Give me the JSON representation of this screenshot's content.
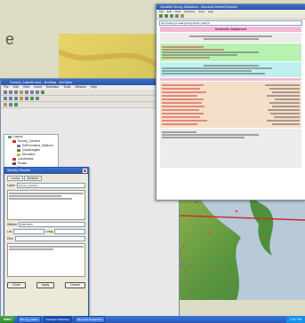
{
  "slide": {
    "partial_text": "e"
  },
  "app": {
    "title": "Survey_Labels.mxd - ArcMap - ArcView",
    "menu": [
      "File",
      "Edit",
      "View",
      "Insert",
      "Selection",
      "Tools",
      "Window",
      "Help"
    ],
    "toc": {
      "items": [
        {
          "label": "Layers",
          "level": 1,
          "color": "#888888"
        },
        {
          "label": "Survey_Centers",
          "level": 2,
          "color": "#c0392b"
        },
        {
          "label": "SelFunctions_Stations",
          "level": 3,
          "color": "#7d7d7d"
        },
        {
          "label": "Quadrangles",
          "level": 3,
          "color": "#4e8b52"
        },
        {
          "label": "Elevation",
          "level": 3,
          "color": "#d8b34a"
        },
        {
          "label": "Landmarks",
          "level": 2,
          "color": "#c0392b"
        },
        {
          "label": "Roads",
          "level": 2,
          "color": "#555555"
        },
        {
          "label": "Rivers",
          "level": 2,
          "color": "#2f6fd0"
        }
      ]
    }
  },
  "dialog": {
    "title": "Identify Results",
    "tabs": [
      "Location",
      "Attributes"
    ],
    "fields": [
      {
        "label": "Layer",
        "value": "Survey_Centers"
      },
      {
        "label": "Station",
        "value": "W30-0072"
      },
      {
        "label": "Lat",
        "value": ""
      },
      {
        "label": "Long",
        "value": ""
      },
      {
        "label": "Elev",
        "value": ""
      }
    ],
    "buttons": [
      "Close",
      "Apply",
      "Cancel"
    ]
  },
  "browser": {
    "title": "Geodetic Survey Datasheet - Microsoft Internet Explorer",
    "menu": [
      "File",
      "Edit",
      "View",
      "Favorites",
      "Tools",
      "Help"
    ],
    "address": "http://www.ngs.noaa.gov/cgi-bin/ds_mark.prl",
    "heading": "Geodetic Datasheet"
  },
  "taskbar": {
    "start_label": "start",
    "tasks": [
      "Survey_Labels",
      "Geodetic Datasheet",
      "Microsoft PowerPoint"
    ],
    "clock": "2:41 PM"
  },
  "colors": {
    "title_bar": "#2a56a8",
    "map_high": "#e9d36a",
    "map_low": "#4f8f3c",
    "water": "#b8c9d8"
  }
}
